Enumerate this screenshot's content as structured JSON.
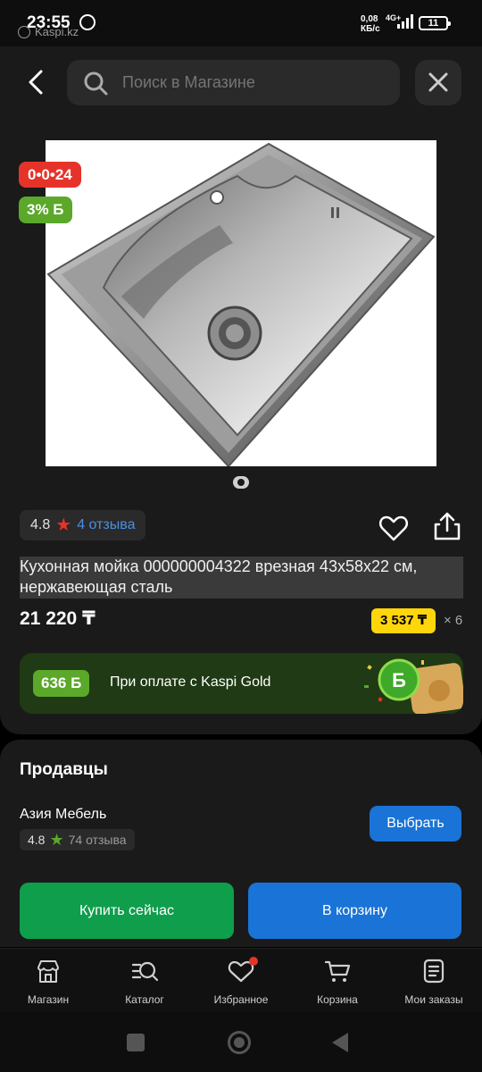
{
  "status_bar": {
    "time": "23:55",
    "kaspi_label": "Kaspi.kz",
    "speed": "0,08\nКБ/с",
    "speed_value": "0,08",
    "speed_unit": "КБ/с",
    "network": "4G+",
    "battery": "11"
  },
  "search": {
    "placeholder": "Поиск в Магазине"
  },
  "product": {
    "installment_badge": "0•0•24",
    "bonus_badge": "3% Б",
    "rating": "4.8",
    "reviews": "4 отзыва",
    "title": "Кухонная мойка 000000004322 врезная 43x58x22 см, нержавеющая сталь",
    "price": "21 220 ₸",
    "installment_price": "3 537 ₸",
    "installment_mult": "× 6"
  },
  "gold_banner": {
    "bonus": "636 Б",
    "text": "При оплате с Kaspi Gold"
  },
  "sellers": {
    "title": "Продавцы",
    "seller_name": "Азия Мебель",
    "seller_rating": "4.8",
    "seller_reviews": "74 отзыва",
    "choose_label": "Выбрать"
  },
  "actions": {
    "buy_now": "Купить сейчас",
    "add_to_cart": "В корзину"
  },
  "bottom_nav": {
    "items": [
      {
        "label": "Магазин",
        "icon": "shop-icon"
      },
      {
        "label": "Каталог",
        "icon": "catalog-search-icon"
      },
      {
        "label": "Избранное",
        "icon": "heart-icon"
      },
      {
        "label": "Корзина",
        "icon": "cart-icon"
      },
      {
        "label": "Мои заказы",
        "icon": "orders-icon"
      }
    ]
  },
  "colors": {
    "installment_red": "#e6332a",
    "bonus_green": "#5ba82a",
    "link_blue": "#4a90e2",
    "button_blue": "#1a73d6",
    "buy_green": "#0f9e4c",
    "installment_yellow": "#ffd60a"
  }
}
